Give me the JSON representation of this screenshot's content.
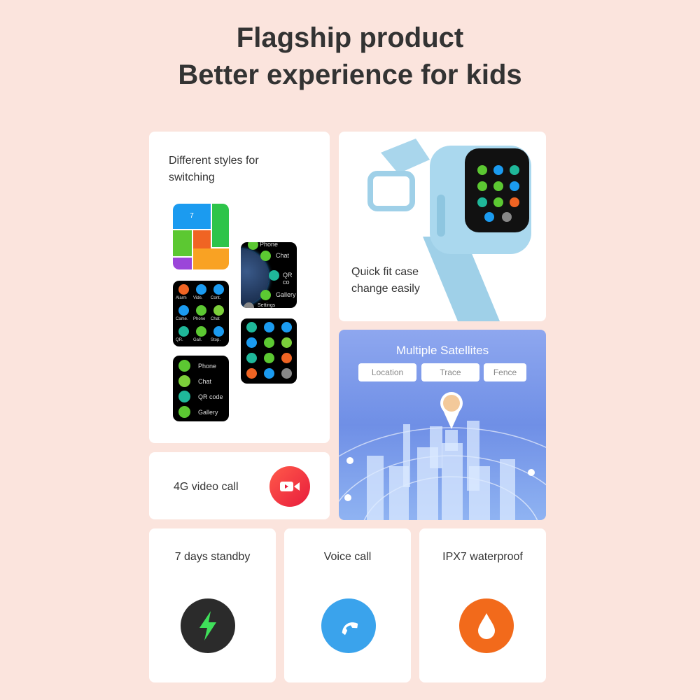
{
  "header": {
    "line1": "Flagship product",
    "line2": "Better experience for kids"
  },
  "styles_card": {
    "label_line1": "Different styles for",
    "label_line2": "switching",
    "screen1": {
      "calendar_day": "7"
    },
    "screen2": {
      "items": [
        "Phone",
        "Chat",
        "QR co",
        "Gallery",
        "Settings"
      ]
    },
    "screen3": {
      "items": [
        "Alarm",
        "Vide.",
        "Cont.",
        "Came.",
        "Phone",
        "Chat",
        "QR.",
        "Gall.",
        "Stop."
      ]
    },
    "screen5": {
      "items": [
        "Phone",
        "Chat",
        "QR code",
        "Gallery"
      ]
    }
  },
  "watch_card": {
    "label_line1": "Quick fit case",
    "label_line2": "change easily"
  },
  "satellites_card": {
    "title": "Multiple Satellites",
    "chips": [
      "Location",
      "Trace",
      "Fence"
    ]
  },
  "video_card": {
    "label": "4G video call",
    "icon": "video-camera-icon",
    "color": "#ee2d3d"
  },
  "features": [
    {
      "label": "7 days standby",
      "icon": "lightning-icon",
      "color": "#2b2b2b"
    },
    {
      "label": "Voice call",
      "icon": "phone-handset-icon",
      "color": "#3aa3ec"
    },
    {
      "label": "IPX7 waterproof",
      "icon": "water-drop-icon",
      "color": "#f26a1b"
    }
  ]
}
